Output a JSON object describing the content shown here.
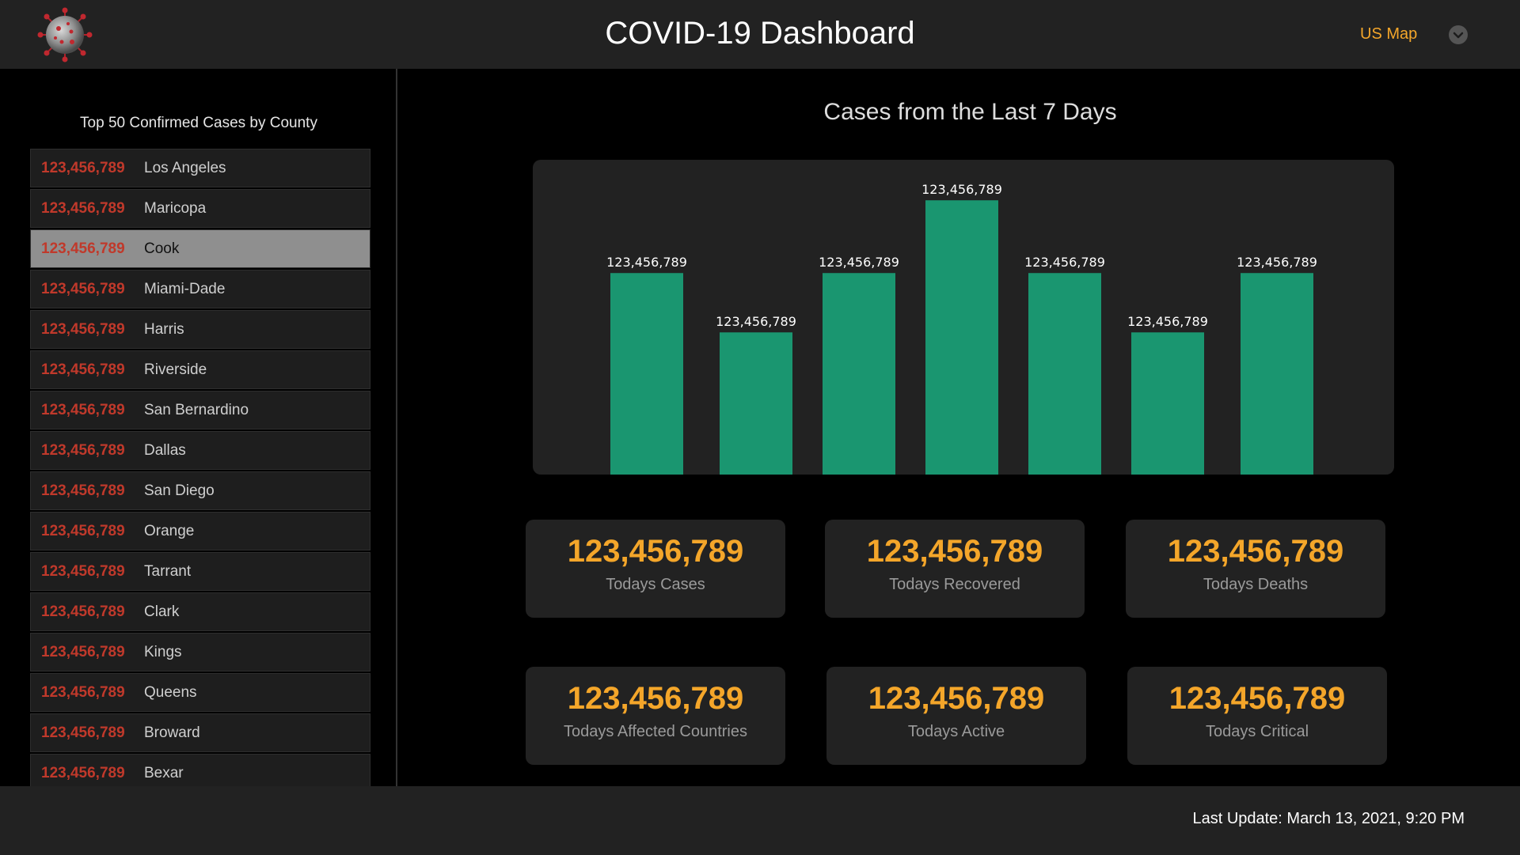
{
  "header": {
    "title": "COVID-19 Dashboard",
    "nav_label": "US Map"
  },
  "sidebar": {
    "title": "Top 50 Confirmed Cases by County",
    "selected_index": 2,
    "counties": [
      {
        "count": "123,456,789",
        "name": "Los Angeles"
      },
      {
        "count": "123,456,789",
        "name": "Maricopa"
      },
      {
        "count": "123,456,789",
        "name": "Cook"
      },
      {
        "count": "123,456,789",
        "name": "Miami-Dade"
      },
      {
        "count": "123,456,789",
        "name": "Harris"
      },
      {
        "count": "123,456,789",
        "name": "Riverside"
      },
      {
        "count": "123,456,789",
        "name": "San Bernardino"
      },
      {
        "count": "123,456,789",
        "name": "Dallas"
      },
      {
        "count": "123,456,789",
        "name": "San Diego"
      },
      {
        "count": "123,456,789",
        "name": "Orange"
      },
      {
        "count": "123,456,789",
        "name": "Tarrant"
      },
      {
        "count": "123,456,789",
        "name": "Clark"
      },
      {
        "count": "123,456,789",
        "name": "Kings"
      },
      {
        "count": "123,456,789",
        "name": "Queens"
      },
      {
        "count": "123,456,789",
        "name": "Broward"
      },
      {
        "count": "123,456,789",
        "name": "Bexar"
      }
    ]
  },
  "chart_data": {
    "type": "bar",
    "title": "Cases from the Last 7 Days",
    "categories": [
      "",
      "",
      "",
      "",
      "",
      "",
      ""
    ],
    "values": [
      180,
      127,
      180,
      245,
      180,
      127,
      180
    ],
    "data_labels": [
      "123,456,789",
      "123,456,789",
      "123,456,789",
      "123,456,789",
      "123,456,789",
      "123,456,789",
      "123,456,789"
    ],
    "ylim": [
      0,
      260
    ],
    "grid": false,
    "bar_color": "#1a9670"
  },
  "stats": [
    {
      "value": "123,456,789",
      "label": "Todays Cases"
    },
    {
      "value": "123,456,789",
      "label": "Todays Recovered"
    },
    {
      "value": "123,456,789",
      "label": "Todays Deaths"
    },
    {
      "value": "123,456,789",
      "label": "Todays Affected Countries"
    },
    {
      "value": "123,456,789",
      "label": "Todays Active"
    },
    {
      "value": "123,456,789",
      "label": "Todays Critical"
    }
  ],
  "footer": {
    "last_update": "Last Update: March 13, 2021, 9:20 PM"
  },
  "colors": {
    "accent": "#f4a62a",
    "count_red": "#c0392b",
    "bar": "#1a9670",
    "panel": "#222222"
  },
  "icons": {
    "logo": "virus-icon",
    "menu": "chevron-down-icon"
  }
}
